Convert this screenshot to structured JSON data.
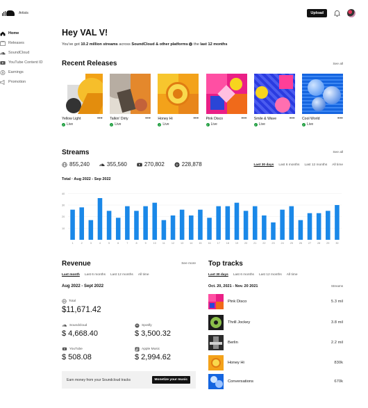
{
  "app": {
    "logo_label": "Artists",
    "upload_label": "Upload"
  },
  "icons": {
    "bell": "bell-icon",
    "avatar": "avatar"
  },
  "sidebar": {
    "items": [
      {
        "label": "Home",
        "icon": "home-icon",
        "active": true
      },
      {
        "label": "Releases",
        "icon": "releases-icon"
      },
      {
        "label": "SoundCloud",
        "icon": "soundcloud-icon"
      },
      {
        "label": "YouTube Content ID",
        "icon": "youtube-icon"
      },
      {
        "label": "Earnings",
        "icon": "earnings-icon"
      },
      {
        "label": "Promotion",
        "icon": "promotion-icon"
      }
    ]
  },
  "greeting": {
    "title": "Hey VAL V!",
    "pre": "You've got ",
    "streams": "10.2 million streams",
    "mid": " across ",
    "platforms": "SoundCloud & other platforms",
    "info": "i",
    "tail": " the ",
    "period": "last 12 months"
  },
  "recent_releases": {
    "title": "Recent Releases",
    "see_all": "See all",
    "items": [
      {
        "name": "Yellow Light",
        "status": "Live",
        "more": "•••"
      },
      {
        "name": "Talkin' Dirty",
        "status": "Live",
        "more": "•••"
      },
      {
        "name": "Honey Hi",
        "status": "Live",
        "more": "•••"
      },
      {
        "name": "Pink Disco",
        "status": "Live",
        "more": "•••"
      },
      {
        "name": "Smile & Wave",
        "status": "Live",
        "more": "•••"
      },
      {
        "name": "Cool World",
        "status": "Live",
        "more": "•••"
      }
    ]
  },
  "streams": {
    "title": "Streams",
    "see_all": "See all",
    "stats": [
      {
        "value": "855,240",
        "icon": "globe-icon"
      },
      {
        "value": "355,560",
        "icon": "soundcloud-icon"
      },
      {
        "value": "270,802",
        "icon": "youtube-icon"
      },
      {
        "value": "228,878",
        "icon": "spotify-icon"
      }
    ],
    "periods": [
      "Last 30 days",
      "Last 6 months",
      "Last 12 months",
      "All time"
    ],
    "selected_period": "Last 30 days",
    "caption": "Total · Aug 2022 - Sep 2022"
  },
  "chart_data": {
    "type": "bar",
    "categories": [
      "1",
      "2",
      "3",
      "4",
      "5",
      "6",
      "7",
      "8",
      "9",
      "10",
      "11",
      "12",
      "13",
      "14",
      "15",
      "16",
      "17",
      "18",
      "19",
      "20",
      "21",
      "22",
      "23",
      "24",
      "25",
      "26",
      "27",
      "28",
      "29",
      "30"
    ],
    "values": [
      26,
      28,
      17,
      36,
      25,
      19,
      29,
      25,
      29,
      32,
      17,
      21,
      26,
      21,
      26,
      19,
      29,
      29,
      32,
      25,
      29,
      21,
      15,
      26,
      29,
      17,
      23,
      23,
      25,
      30
    ],
    "yticks": [
      "10",
      "20",
      "30",
      "40"
    ],
    "ylim": [
      0,
      42
    ],
    "bar_color": "#1a88e8",
    "grid": true,
    "title": "",
    "xlabel": "",
    "ylabel": ""
  },
  "revenue": {
    "title": "Revenue",
    "see_more": "See more",
    "periods": [
      "Last month",
      "Last 6 months",
      "Last 12 months",
      "All time"
    ],
    "selected_period": "Last month",
    "date_range": "Aug 2022 - Sept 2022",
    "total_label": "Total",
    "total_value": "$11,671.42",
    "sources": [
      {
        "label": "Soundcloud",
        "value": "$ 4,668.40",
        "icon": "soundcloud-icon"
      },
      {
        "label": "Spotify",
        "value": "$ 3,500.32",
        "icon": "spotify-icon"
      },
      {
        "label": "YouTube",
        "value": "$ 508.08",
        "icon": "youtube-icon"
      },
      {
        "label": "Apple Music",
        "value": "$ 2,994.62",
        "icon": "apple-music-icon"
      }
    ],
    "banner_text": "Earn money from your Soundcloud tracks",
    "banner_button": "Monetize your music"
  },
  "top_tracks": {
    "title": "Top tracks",
    "periods": [
      "Last 30 days",
      "Last 6 months",
      "Last 12 months",
      "All time"
    ],
    "selected_period": "Last 30 days",
    "date_range": "Oct. 20, 2021 - Nov. 20 2021",
    "streams_header": "Streams",
    "tracks": [
      {
        "name": "Pink Disco",
        "streams": "5.3 mil"
      },
      {
        "name": "Thrill Jockey",
        "streams": "3.8 mil"
      },
      {
        "name": "Berlin",
        "streams": "2.2 mil"
      },
      {
        "name": "Honey Hi",
        "streams": "830k"
      },
      {
        "name": "Conversations",
        "streams": "670k"
      }
    ]
  },
  "colors": {
    "accent_blue": "#1a88e8",
    "live_green": "#1b9c3c",
    "text": "#111111"
  }
}
